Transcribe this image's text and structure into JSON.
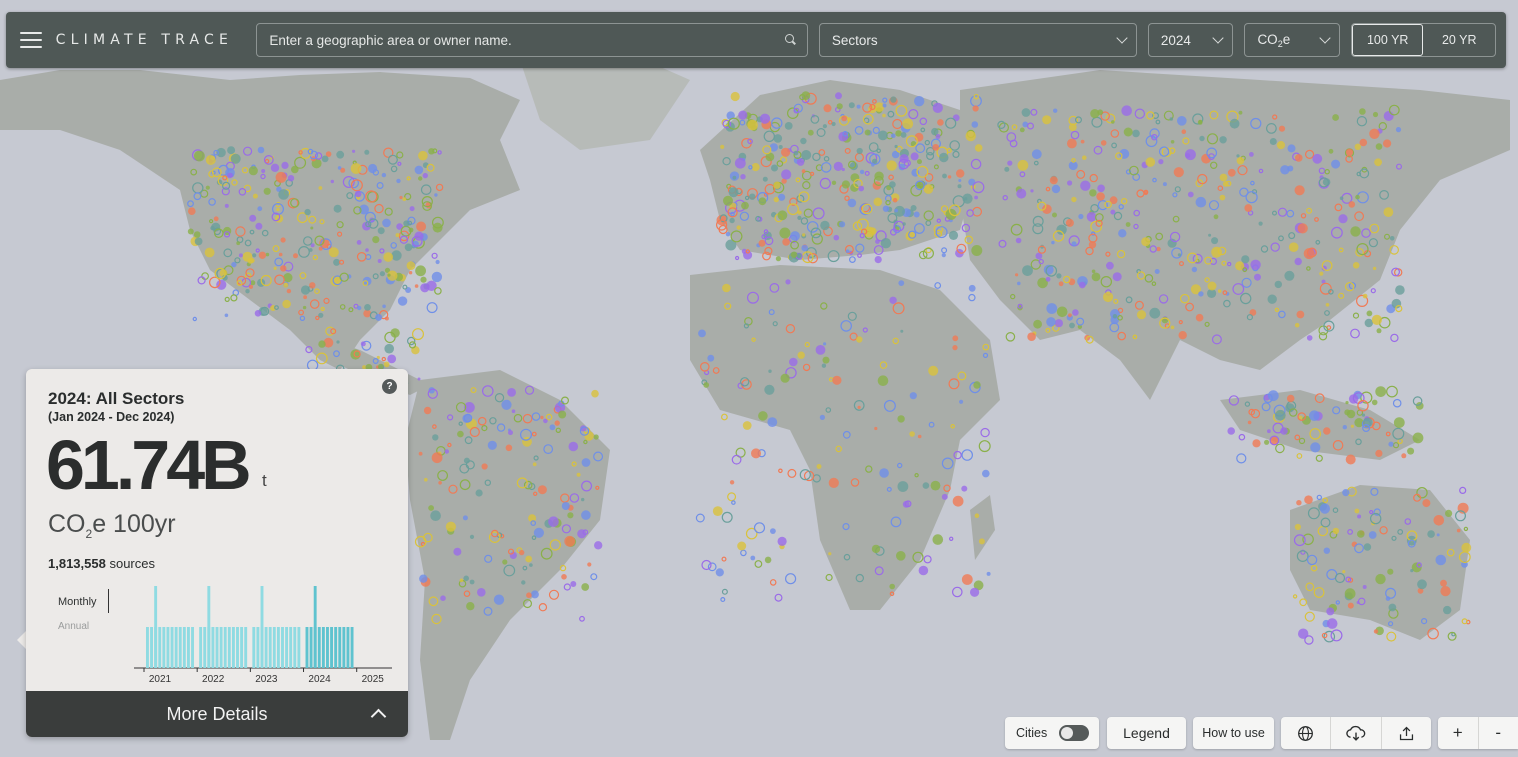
{
  "app": {
    "logo_text": "CLIMATE TRACE",
    "search": {
      "placeholder": "Enter a geographic area or owner name."
    },
    "sectors_dropdown": "Sectors",
    "year_dropdown": "2024",
    "gas_dropdown": {
      "main": "CO",
      "sub": "2",
      "rest": "e"
    },
    "gwp_toggle": {
      "options": [
        "100 YR",
        "20 YR"
      ],
      "selected": "100 YR"
    }
  },
  "summary": {
    "title": "2024: All Sectors",
    "period": "(Jan 2024 - Dec 2024)",
    "total": "61.74B",
    "unit": "t",
    "gas_label": {
      "main": "CO",
      "sub": "2",
      "rest": "e 100yr"
    },
    "sources_count": "1,813,558",
    "sources_label": "sources",
    "help": "?",
    "toggle": {
      "monthly": "Monthly",
      "annual": "Annual"
    },
    "more_details": "More Details"
  },
  "chart_data": {
    "type": "bar",
    "categories": [
      "2021",
      "2022",
      "2023",
      "2024",
      "2025"
    ],
    "series": [
      {
        "values": [
          0.5,
          0.5,
          0.5,
          0.5,
          0.5,
          0.5,
          0.5,
          0.5,
          0.5,
          0.5,
          0.5,
          0.5,
          0.5,
          0.5,
          0.5,
          0.5,
          0.5,
          0.5,
          0.5,
          0.5,
          0.5,
          0.5,
          0.5,
          0.5,
          0.5,
          0.5,
          0.5,
          0.5,
          0.5,
          0.5,
          0.5,
          0.5,
          0.5,
          0.5,
          0.5,
          0.5,
          0.5,
          0.5,
          0.5,
          0.5,
          0.5,
          0.5,
          0.5,
          0.5,
          0.5,
          0.5,
          0.5,
          0.5
        ]
      }
    ],
    "spikes": [
      1.0,
      1.0,
      1.0,
      1.0
    ],
    "highlight": "2024",
    "bar_color": "#8fdbe2",
    "highlight_color": "#5fc3cf"
  },
  "controls": {
    "cities_label": "Cities",
    "cities_on": false,
    "legend_label": "Legend",
    "how_to_label": "How to use",
    "icons": [
      "globe-icon",
      "cloud-download-icon",
      "share-upload-icon"
    ],
    "zoom_in": "+",
    "zoom_out": "-"
  },
  "map": {
    "ocean_color": "#c6c9d2",
    "land_color": "#a9ada9",
    "dot_colors": [
      "#6a9f9b",
      "#9a6be8",
      "#f07a55",
      "#8ab04a",
      "#6f8fe8",
      "#d9c23c"
    ]
  }
}
